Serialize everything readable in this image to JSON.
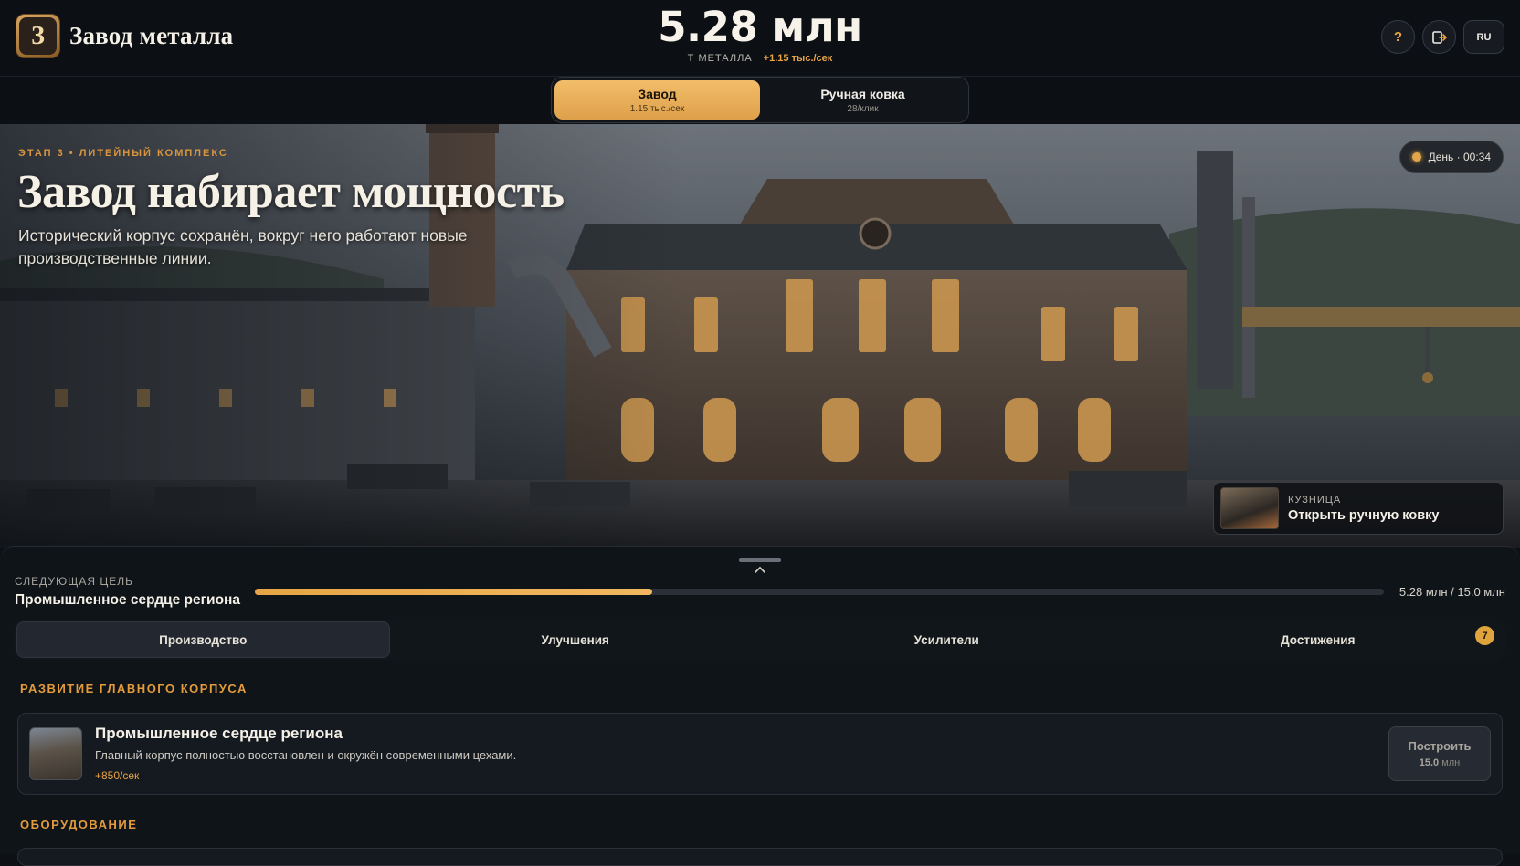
{
  "header": {
    "app_title": "Завод металла",
    "logo_glyph": "З",
    "counter_value": "5.28 млн",
    "counter_unit": "Т МЕТАЛЛА",
    "counter_rate": "+1.15 тыс./сек",
    "help_label": "?",
    "exit_icon": "logout-icon",
    "lang_label": "RU"
  },
  "modes": [
    {
      "name": "Завод",
      "rate": "1.15 тыс./сек",
      "active": true
    },
    {
      "name": "Ручная ковка",
      "rate": "28/клик",
      "active": false
    }
  ],
  "hero": {
    "stage": "ЭТАП 3 • ЛИТЕЙНЫЙ КОМПЛЕКС",
    "title": "Завод набирает мощность",
    "description": "Исторический корпус сохранён, вокруг него работают новые производственные линии.",
    "time_label": "День · 00:34",
    "forge_label": "КУЗНИЦА",
    "forge_action": "Открыть ручную ковку"
  },
  "goal": {
    "label": "СЛЕДУЮЩАЯ ЦЕЛЬ",
    "name": "Промышленное сердце региона",
    "progress": 0.352,
    "amount": "5.28 млн / 15.0 млн"
  },
  "tabs": [
    {
      "label": "Производство",
      "active": true
    },
    {
      "label": "Улучшения",
      "active": false
    },
    {
      "label": "Усилители",
      "active": false
    },
    {
      "label": "Достижения",
      "active": false,
      "badge": "7"
    }
  ],
  "sections": {
    "main_building": "РАЗВИТИЕ ГЛАВНОГО КОРПУСА",
    "equipment": "ОБОРУДОВАНИЕ"
  },
  "building": {
    "name": "Промышленное сердце региона",
    "description": "Главный корпус полностью восстановлен и окружён современными цехами.",
    "income": "+850/сек",
    "button_label": "Построить",
    "cost_value": "15.0",
    "cost_unit": "млн"
  },
  "colors": {
    "accent": "#e7a445",
    "background": "#0d1116",
    "panel": "#141a20"
  }
}
